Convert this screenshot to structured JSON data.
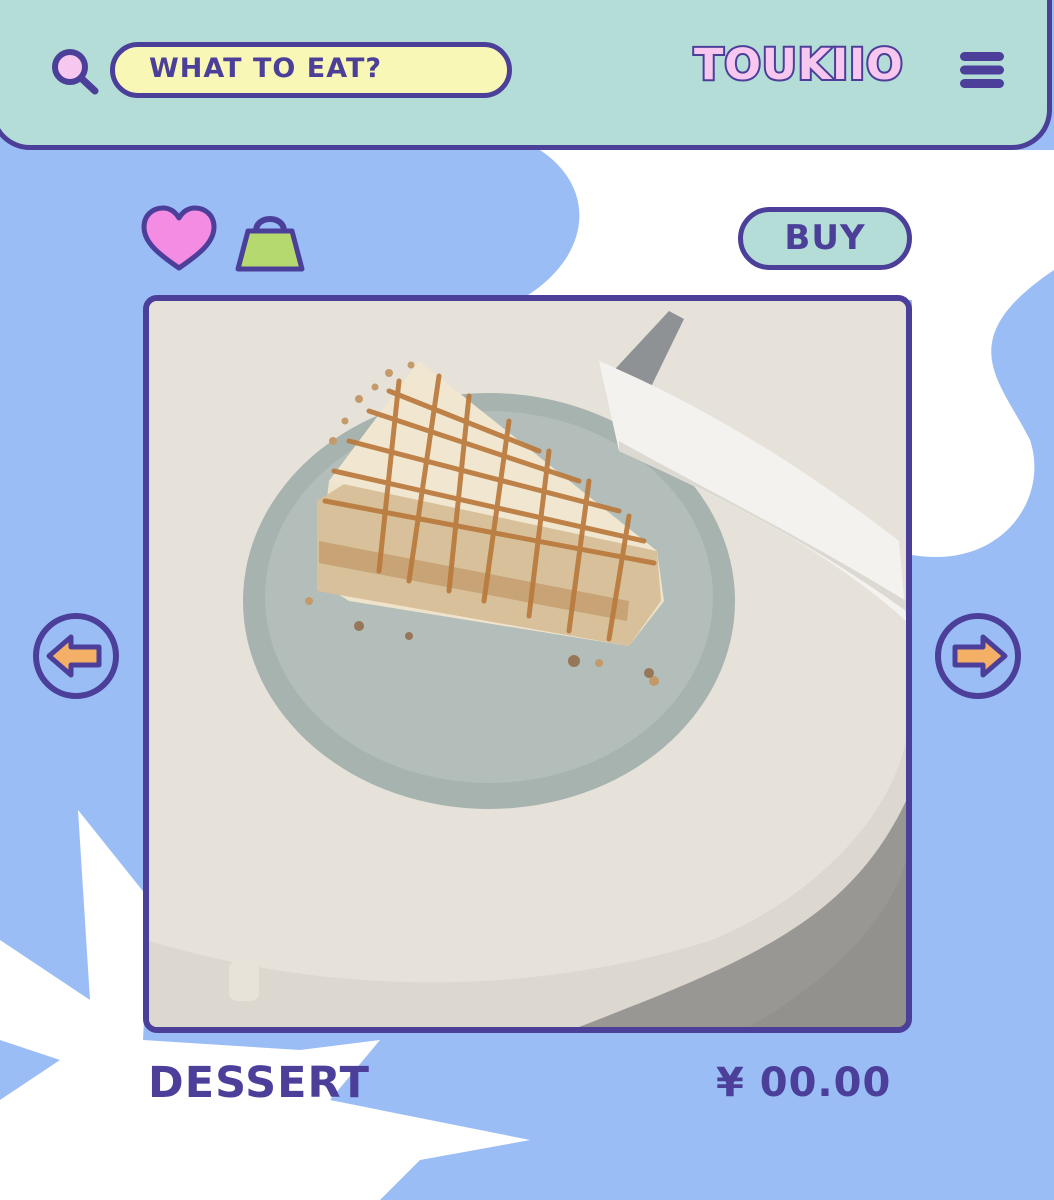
{
  "header": {
    "search_placeholder": "WHAT TO EAT?",
    "brand": "TOUKIIO"
  },
  "actions": {
    "buy_label": "BUY"
  },
  "product": {
    "name": "DESSERT",
    "price": "¥ 00.00",
    "image_subject": "slice of caramel drizzled layer cake on grey plate"
  },
  "colors": {
    "outline": "#4b3f9a",
    "header_bg": "#b3ddd6",
    "search_bg": "#f8f7b6",
    "page_bg": "#9bbdf5",
    "heart": "#f58ce4",
    "bag": "#b6d96f",
    "arrow_fill": "#f4b066",
    "brand_fill": "#f7c7f0"
  },
  "icons": {
    "search": "search-icon",
    "menu": "menu-icon",
    "like": "heart-icon",
    "cart": "shopping-bag-icon",
    "prev": "arrow-left-icon",
    "next": "arrow-right-icon"
  }
}
